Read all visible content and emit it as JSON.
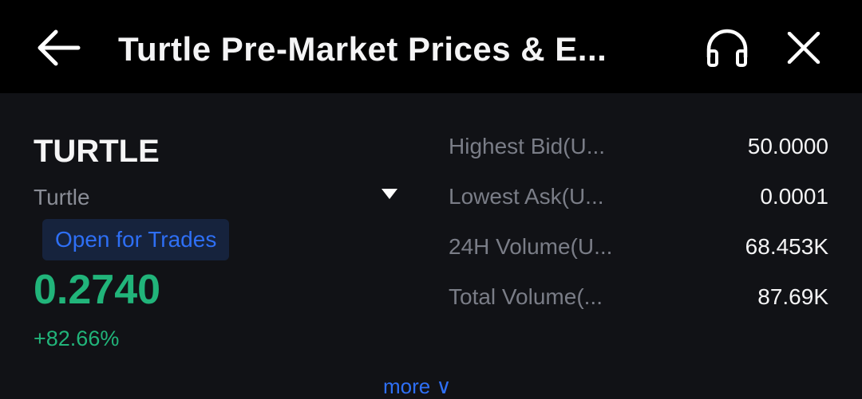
{
  "header": {
    "title": "Turtle Pre-Market Prices & E...",
    "back_icon": "arrow-left-icon",
    "support_icon": "headset-icon",
    "close_icon": "close-icon"
  },
  "token": {
    "symbol": "TURTLE",
    "name": "Turtle",
    "status": "Open for Trades",
    "price": "0.2740",
    "change": "+82.66%"
  },
  "stats": [
    {
      "label": "Highest Bid(U...",
      "value": "50.0000"
    },
    {
      "label": "Lowest Ask(U...",
      "value": "0.0001"
    },
    {
      "label": "24H Volume(U...",
      "value": "68.453K"
    },
    {
      "label": "Total Volume(...",
      "value": "87.69K"
    }
  ],
  "more_link": "more ∨",
  "colors": {
    "background": "#111216",
    "header": "#000000",
    "positive": "#21b47a",
    "accent": "#2e6ff5",
    "badge_bg": "#16233d"
  }
}
